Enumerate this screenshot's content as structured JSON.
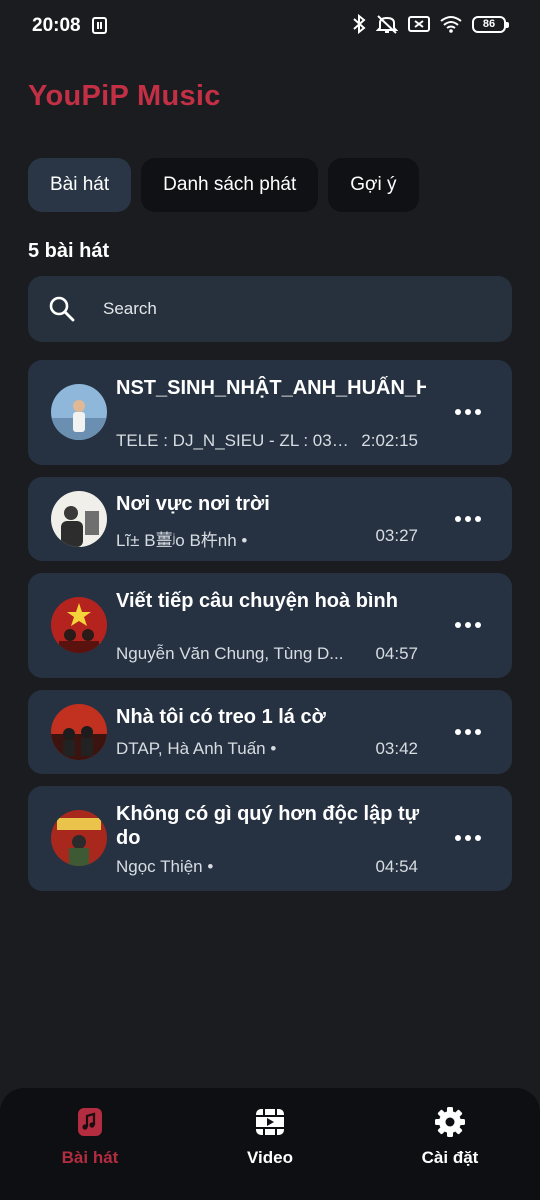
{
  "status_bar": {
    "time": "20:08",
    "battery": "86"
  },
  "app": {
    "title": "YouPiP Music"
  },
  "tabs": [
    {
      "label": "Bài hát",
      "active": true
    },
    {
      "label": "Danh sách phát",
      "active": false
    },
    {
      "label": "Gợi ý",
      "active": false
    }
  ],
  "song_count": "5 bài hát",
  "search": {
    "placeholder": "Search"
  },
  "songs": [
    {
      "title": "NST_SINH_NHẬT_ANH_HUẤN_HOA_HỒNG_ĐẶT_TẶNG_E...",
      "artist": "TELE : DJ_N_SIEU - ZL : 032...",
      "duration": "2:02:15"
    },
    {
      "title": "Nơi vực nơi trời",
      "artist": "Lĩ± B薑ʲo B杵nh •",
      "duration": "03:27"
    },
    {
      "title": "Viết tiếp câu chuyện hoà bình",
      "artist": "Nguyễn Văn Chung, Tùng D...",
      "duration": "04:57"
    },
    {
      "title": "Nhà tôi có treo 1 lá cờ",
      "artist": "DTAP, Hà Anh Tuấn •",
      "duration": "03:42"
    },
    {
      "title": "Không có gì quý hơn độc lập tự do",
      "artist": "Ngọc Thiện •",
      "duration": "04:54"
    }
  ],
  "bottom_nav": [
    {
      "label": "Bài hát",
      "icon": "music-note-icon",
      "active": true
    },
    {
      "label": "Video",
      "icon": "video-icon",
      "active": false
    },
    {
      "label": "Cài đặt",
      "icon": "gear-icon",
      "active": false
    }
  ],
  "colors": {
    "accent": "#c33045",
    "card": "#263241",
    "background": "#1a1c20"
  }
}
